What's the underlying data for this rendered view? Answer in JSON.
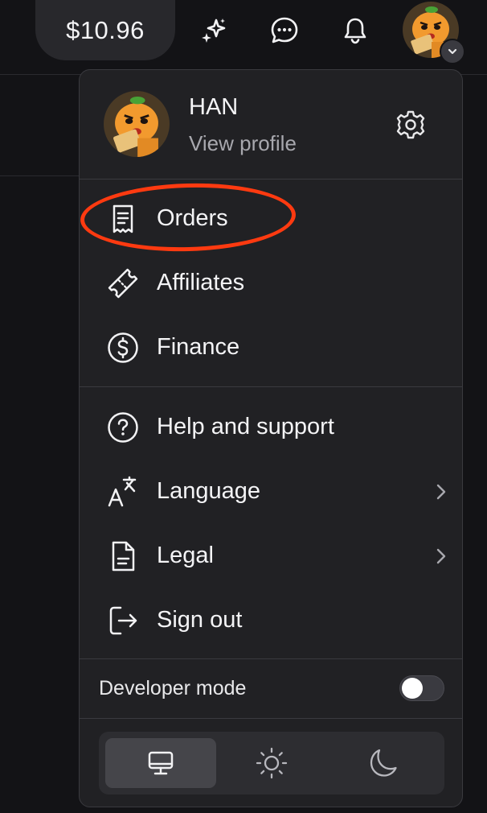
{
  "topbar": {
    "balance": "$10.96",
    "icons": [
      "sparkles-icon",
      "chat-bubble-icon",
      "bell-icon"
    ],
    "avatar_chevron": "chevron-down-icon"
  },
  "profile": {
    "name": "HAN",
    "link": "View profile",
    "settings_icon": "gear-icon"
  },
  "menu": {
    "group1": [
      {
        "label": "Orders",
        "icon": "receipt-icon"
      },
      {
        "label": "Affiliates",
        "icon": "ticket-icon"
      },
      {
        "label": "Finance",
        "icon": "dollar-circle-icon"
      }
    ],
    "group2": [
      {
        "label": "Help and support",
        "icon": "question-circle-icon"
      },
      {
        "label": "Language",
        "icon": "translate-icon"
      },
      {
        "label": "Legal",
        "icon": "document-icon"
      },
      {
        "label": "Sign out",
        "icon": "sign-out-icon"
      }
    ]
  },
  "developer_mode": {
    "label": "Developer mode",
    "enabled": false
  },
  "theme": {
    "options": [
      "system",
      "light",
      "dark"
    ],
    "selected": "system"
  },
  "colors": {
    "background": "#131316",
    "menu_background": "#212124",
    "highlight": "#ff3a10"
  }
}
